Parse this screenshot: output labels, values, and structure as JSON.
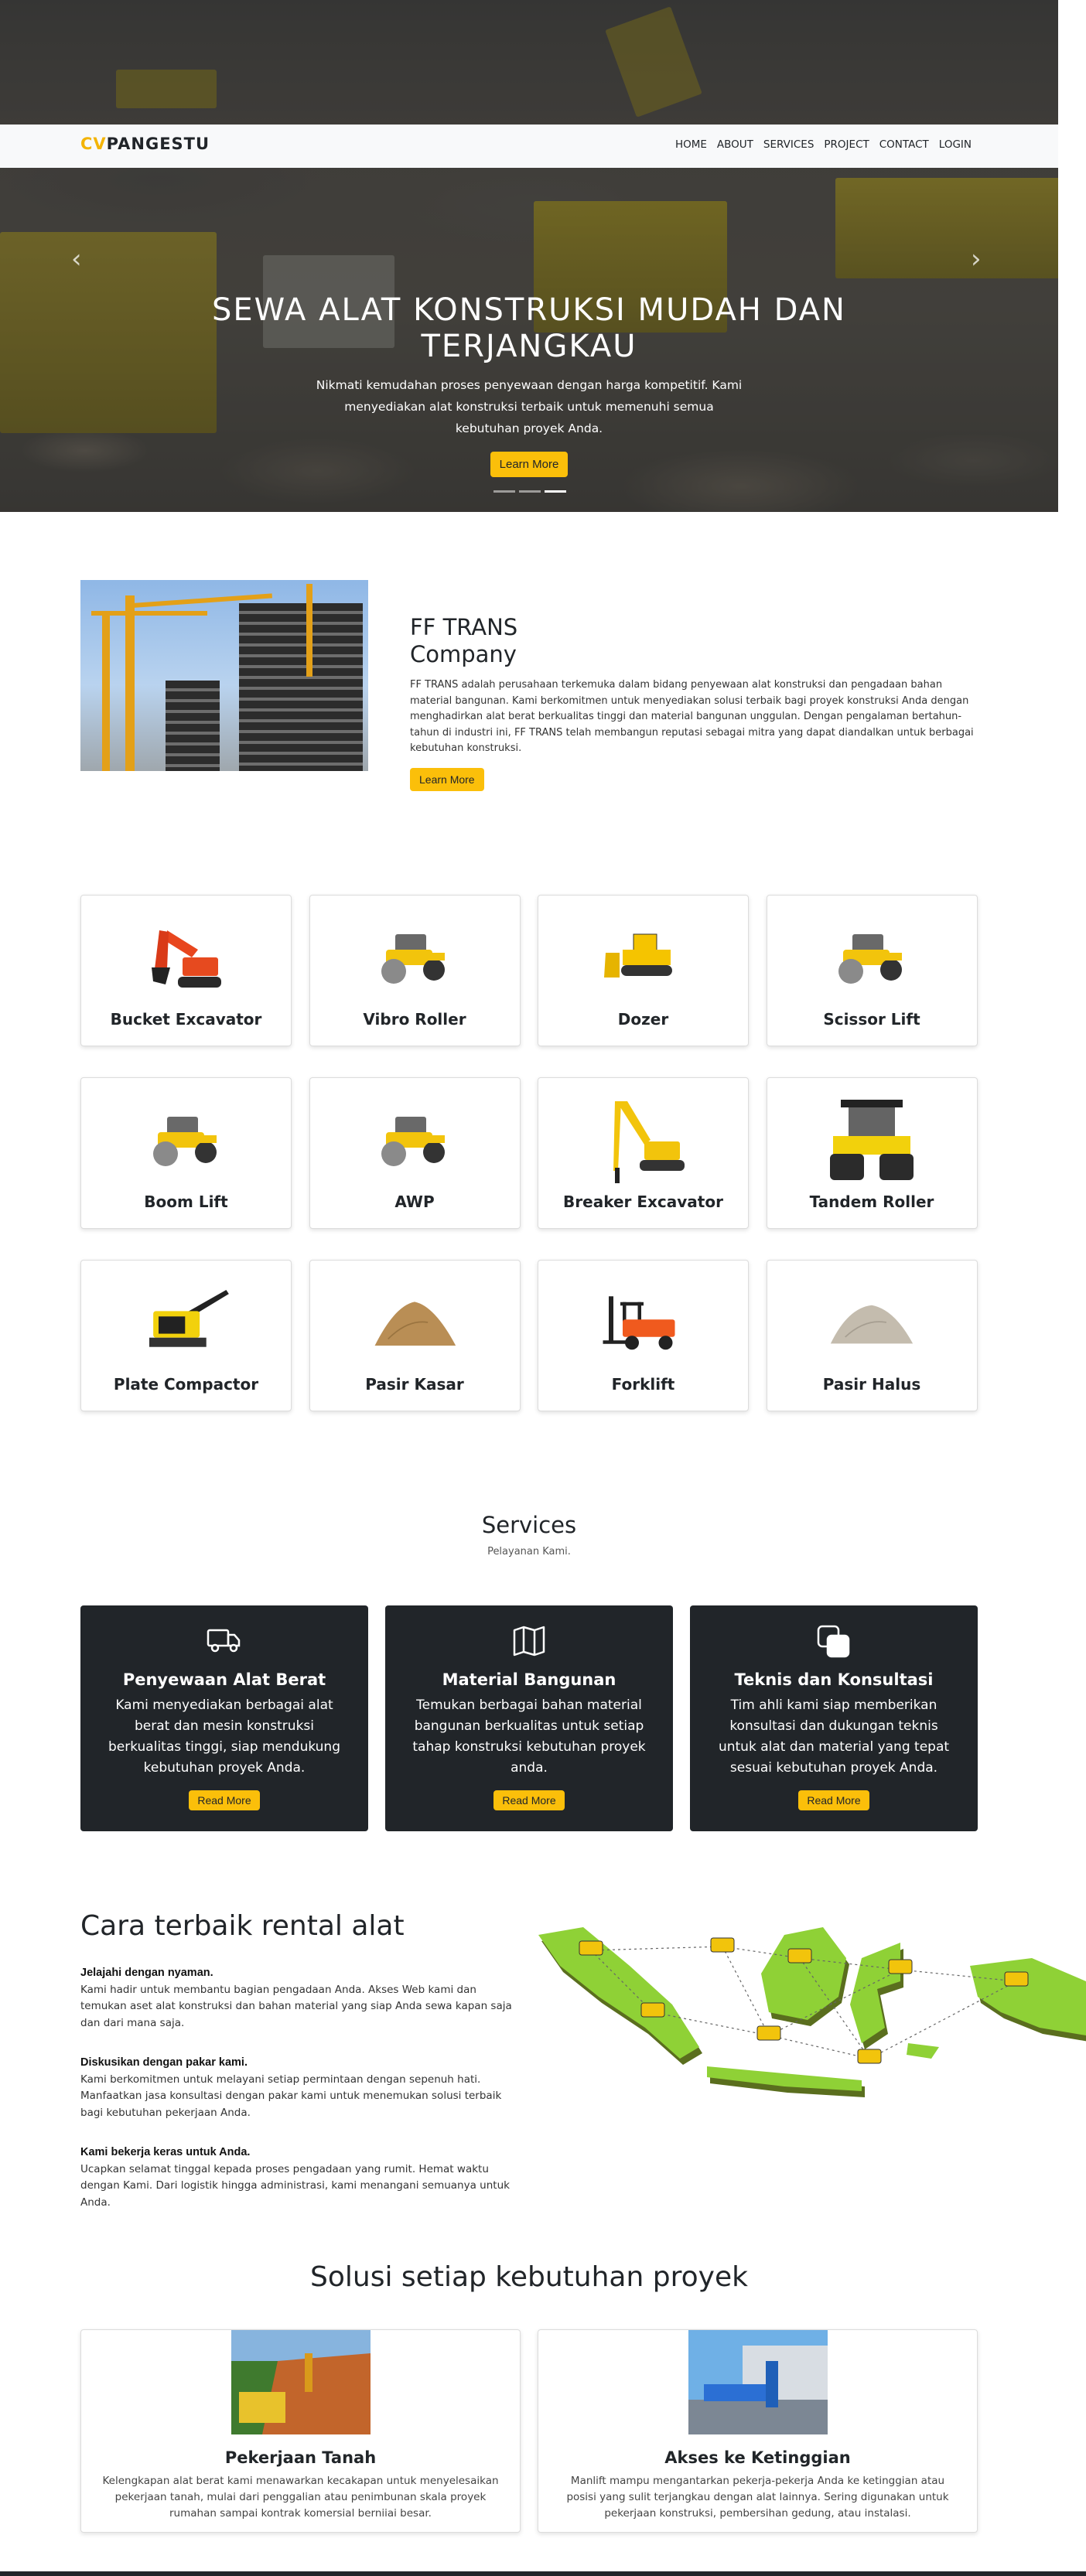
{
  "brand": {
    "prefix": "CV",
    "name": "PANGESTU"
  },
  "nav": {
    "items": [
      "HOME",
      "ABOUT",
      "SERVICES",
      "PROJECT",
      "CONTACT",
      "LOGIN"
    ]
  },
  "hero": {
    "title": "SEWA ALAT KONSTRUKSI MUDAH DAN TERJANGKAU",
    "text": "Nikmati kemudahan proses penyewaan dengan harga kompetitif. Kami menyediakan alat konstruksi terbaik untuk memenuhi semua kebutuhan proyek Anda.",
    "button": "Learn More",
    "slides": 3,
    "active_slide": 3
  },
  "about": {
    "title": "FF TRANS Company",
    "text": "FF TRANS adalah perusahaan terkemuka dalam bidang penyewaan alat konstruksi dan pengadaan bahan material bangunan. Kami berkomitmen untuk menyediakan solusi terbaik bagi proyek konstruksi Anda dengan menghadirkan alat berat berkualitas tinggi dan material bangunan unggulan. Dengan pengalaman bertahun-tahun di industri ini, FF TRANS telah membangun reputasi sebagai mitra yang dapat diandalkan untuk berbagai kebutuhan konstruksi.",
    "button": "Learn More"
  },
  "equipment": [
    {
      "name": "Bucket Excavator",
      "icon": "excavator-red"
    },
    {
      "name": "Vibro Roller",
      "icon": "roller"
    },
    {
      "name": "Dozer",
      "icon": "dozer"
    },
    {
      "name": "Scissor Lift",
      "icon": "roller"
    },
    {
      "name": "Boom Lift",
      "icon": "roller"
    },
    {
      "name": "AWP",
      "icon": "roller"
    },
    {
      "name": "Breaker Excavator",
      "icon": "breaker"
    },
    {
      "name": "Tandem Roller",
      "icon": "tandem"
    },
    {
      "name": "Plate Compactor",
      "icon": "compactor"
    },
    {
      "name": "Pasir Kasar",
      "icon": "sand-brown"
    },
    {
      "name": "Forklift",
      "icon": "forklift"
    },
    {
      "name": "Pasir Halus",
      "icon": "sand-grey"
    }
  ],
  "services": {
    "title": "Services",
    "subtitle": "Pelayanan Kami.",
    "cards": [
      {
        "icon": "truck-icon",
        "title": "Penyewaan Alat Berat",
        "text": "Kami menyediakan berbagai alat berat dan mesin konstruksi berkualitas tinggi, siap mendukung kebutuhan proyek Anda.",
        "button": "Read More"
      },
      {
        "icon": "map-icon",
        "title": "Material Bangunan",
        "text": "Temukan berbagai bahan material bangunan berkualitas untuk setiap tahap konstruksi kebutuhan proyek anda.",
        "button": "Read More"
      },
      {
        "icon": "layers-icon",
        "title": "Teknis dan Konsultasi",
        "text": "Tim ahli kami siap memberikan konsultasi dan dukungan teknis untuk alat dan material yang tepat sesuai kebutuhan proyek Anda.",
        "button": "Read More"
      }
    ]
  },
  "rental": {
    "title": "Cara terbaik rental alat",
    "blocks": [
      {
        "heading": "Jelajahi dengan nyaman.",
        "text": "Kami hadir untuk membantu bagian pengadaan Anda. Akses Web kami dan temukan aset alat konstruksi dan bahan material yang siap Anda sewa kapan saja dan dari mana saja."
      },
      {
        "heading": "Diskusikan dengan pakar kami.",
        "text": "Kami berkomitmen untuk melayani setiap permintaan dengan sepenuh hati. Manfaatkan jasa konsultasi dengan pakar kami untuk menemukan solusi terbaik bagi kebutuhan pekerjaan Anda."
      },
      {
        "heading": "Kami bekerja keras untuk Anda.",
        "text": "Ucapkan selamat tinggal kepada proses pengadaan yang rumit. Hemat waktu dengan Kami. Dari logistik hingga administrasi, kami menangani semuanya untuk Anda."
      }
    ]
  },
  "solutions": {
    "title": "Solusi setiap kebutuhan proyek",
    "cards": [
      {
        "title": "Pekerjaan Tanah",
        "text": "Kelengkapan alat berat kami menawarkan kecakapan untuk menyelesaikan pekerjaan tanah, mulai dari penggalian atau penimbunan skala proyek rumahan sampai kontrak komersial berniiai besar."
      },
      {
        "title": "Akses ke Ketinggian",
        "text": "Manlift mampu mengantarkan pekerja-pekerja Anda ke ketinggian atau posisi yang sulit terjangkau dengan alat lainnya. Sering digunakan untuk pekerjaan konstruksi, pembersihan gedung, atau instalasi."
      }
    ]
  },
  "colors": {
    "accent": "#fbbf0a",
    "dark": "#212529",
    "map_green": "#8fd136"
  }
}
